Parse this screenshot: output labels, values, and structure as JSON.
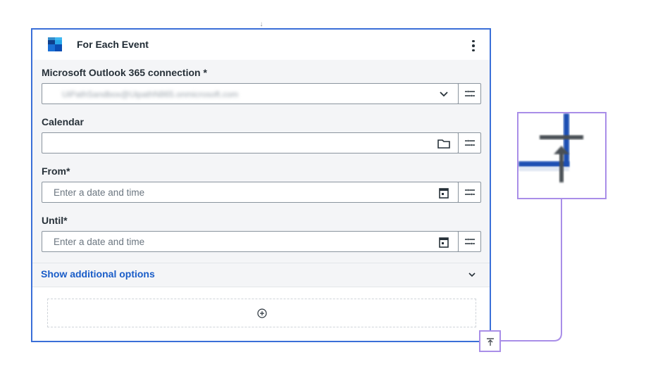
{
  "card": {
    "title": "For Each Event",
    "icon": "outlook-calendar-icon",
    "menu_icon": "kebab-menu-icon"
  },
  "fields": {
    "connection": {
      "label": "Microsoft Outlook 365 connection *",
      "value": "UiPathSandbox@UipathN865.onmicrosoft.com",
      "end_icon": "chevron-down-icon"
    },
    "calendar": {
      "label": "Calendar",
      "value": "",
      "end_icon": "folder-icon"
    },
    "from": {
      "label": "From*",
      "placeholder": "Enter a date and time",
      "end_icon": "calendar-icon"
    },
    "until": {
      "label": "Until*",
      "placeholder": "Enter a date and time",
      "end_icon": "calendar-icon"
    }
  },
  "options": {
    "label": "Show additional options",
    "icon": "chevron-down-icon"
  },
  "drop_zone": {
    "icon": "add-circle-icon"
  },
  "colors": {
    "accent": "#3a6fd8",
    "link": "#1a5dc8",
    "highlight": "#a98ee8",
    "panel_bg": "#f4f5f7"
  }
}
